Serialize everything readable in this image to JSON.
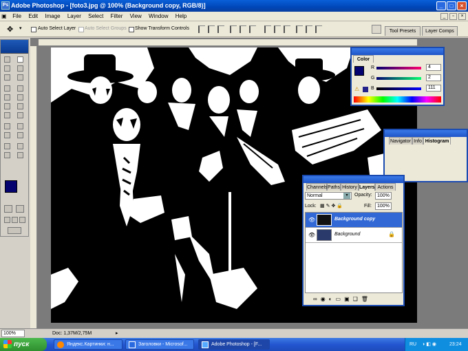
{
  "window": {
    "title": "Adobe Photoshop - [foto3.jpg @ 100% (Background copy, RGB/8)]",
    "minimize": "_",
    "maximize": "□",
    "close": "×"
  },
  "menu": [
    "File",
    "Edit",
    "Image",
    "Layer",
    "Select",
    "Filter",
    "View",
    "Window",
    "Help"
  ],
  "options": {
    "auto_select_layer": "Auto Select Layer",
    "auto_select_groups": "Auto Select Groups",
    "show_transform": "Show Transform Controls"
  },
  "wells": {
    "tool_presets": "Tool Presets",
    "layer_comps": "Layer Comps"
  },
  "color_panel": {
    "title": "Color",
    "r_label": "R",
    "g_label": "G",
    "b_label": "B",
    "r_value": "4",
    "g_value": "2",
    "b_value": "111",
    "foreground": "#04026f"
  },
  "nav_panel": {
    "tabs": [
      "Navigator",
      "Info",
      "Histogram"
    ]
  },
  "layers_panel": {
    "tabs": [
      "Channels",
      "Paths",
      "History",
      "Layers",
      "Actions"
    ],
    "blend_mode": "Normal",
    "opacity_label": "Opacity:",
    "opacity_value": "100%",
    "lock_label": "Lock:",
    "fill_label": "Fill:",
    "fill_value": "100%",
    "layers": [
      {
        "name": "Background copy",
        "selected": true
      },
      {
        "name": "Background",
        "selected": false
      }
    ]
  },
  "status": {
    "zoom": "100%",
    "doc": "Doc: 1,37M/2,75M"
  },
  "taskbar": {
    "start": "пуск",
    "tasks": [
      "Яндекс.Картинки: н...",
      "Заголовки - Microsof...",
      "Adobe Photoshop - [F..."
    ],
    "lang": "RU",
    "time": "23:24"
  }
}
